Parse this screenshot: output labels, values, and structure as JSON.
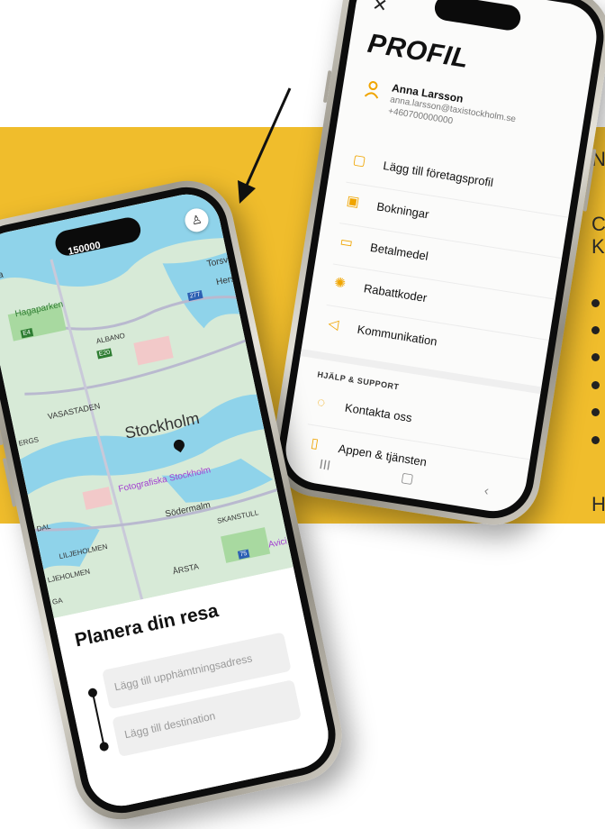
{
  "side_text": {
    "line1": "N",
    "line2": "C",
    "line3": "K",
    "line4": "H"
  },
  "profile_screen": {
    "close_icon": "close-icon",
    "title": "PROFIL",
    "user": {
      "name": "Anna Larsson",
      "email": "anna.larsson@taxistockholm.se",
      "phone": "+460700000000"
    },
    "menu": [
      {
        "label": "Lägg till företagsprofil",
        "icon": "briefcase-icon"
      },
      {
        "label": "Bokningar",
        "icon": "calendar-icon"
      },
      {
        "label": "Betalmedel",
        "icon": "card-icon"
      },
      {
        "label": "Rabattkoder",
        "icon": "discount-icon"
      },
      {
        "label": "Kommunikation",
        "icon": "megaphone-icon"
      }
    ],
    "section_title": "HJÄLP & SUPPORT",
    "support": [
      {
        "label": "Kontakta oss",
        "icon": "chat-icon"
      },
      {
        "label": "Appen & tjänsten",
        "icon": "phone-info-icon"
      }
    ],
    "nav": {
      "recent": "III",
      "home": "▢",
      "back": "‹"
    }
  },
  "map_screen": {
    "logo_text": "150000",
    "city": "Stockholm",
    "labels": {
      "hagaparken": "Hagaparken",
      "vasastaden": "VASASTADEN",
      "albano": "ALBANO",
      "sodermalm": "Södermalm",
      "skanstull": "SKANSTULL",
      "liljeholmen1": "LILJEHOLMEN",
      "liljeholmen2": "LJEHOLMEN",
      "arsta": "ÅRSTA",
      "fotografiska": "Fotografiska Stockholm",
      "avicii": "Avici",
      "torsv": "Torsv",
      "hersen": "Herse",
      "lunda": "unda",
      "lna": "lna",
      "ergs": "ERGS",
      "dal": "DAL",
      "ga": "GA",
      "e4": "E4",
      "e20": "E20",
      "r277": "277",
      "r75": "75"
    },
    "plan": {
      "title": "Planera din resa",
      "pickup_placeholder": "Lägg till upphämtningsadress",
      "destination_placeholder": "Lägg till destination"
    },
    "nav": {
      "recent": "III",
      "home": "▢",
      "back": "‹"
    }
  },
  "colors": {
    "band": "#f0bd2c",
    "accent": "#f0a500",
    "map_water": "#8fd3ea",
    "map_land": "#cfe6cf"
  }
}
